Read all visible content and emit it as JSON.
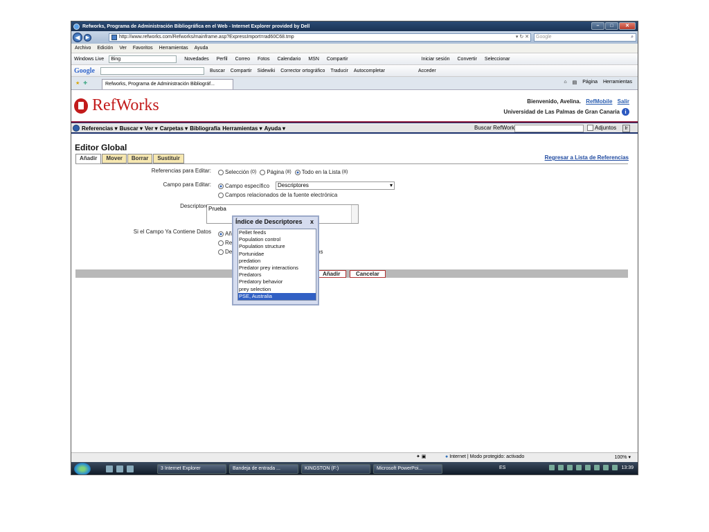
{
  "window": {
    "title": "Refworks, Programa de Administración Bibliográfica en el Web - Internet Explorer provided by Dell",
    "url": "http://www.refworks.com/Refworks/mainframe.asp?ExpressImport=rad60C68.tmp",
    "search_placeholder": "Google"
  },
  "menu": [
    "Archivo",
    "Edición",
    "Ver",
    "Favoritos",
    "Herramientas",
    "Ayuda"
  ],
  "live_toolbar": {
    "brand": "Windows Live",
    "search_value": "Bing",
    "items": [
      "Novedades",
      "Perfil",
      "Correo",
      "Fotos",
      "Calendario",
      "MSN",
      "Compartir"
    ],
    "right_items": [
      "Iniciar sesión",
      "Convertir",
      "Seleccionar"
    ]
  },
  "google_toolbar": {
    "brand": "Google",
    "items": [
      "Buscar",
      "Compartir",
      "Sidewiki",
      "Corrector ortográfico",
      "Traducir",
      "Autocompletar",
      "Acceder"
    ]
  },
  "tab": {
    "label": "Refworks, Programa de Administración Bibliográf...",
    "tools": [
      "Página",
      "Herramientas"
    ]
  },
  "header": {
    "logo": "RefWorks",
    "welcome": "Bienvenido, Avelina.",
    "refmobile": "RefMobile",
    "salir": "Salir",
    "university": "Universidad de Las Palmas de Gran Canaria"
  },
  "nav": {
    "items": [
      "Referencias",
      "Buscar",
      "Ver",
      "Carpetas",
      "Bibliografía",
      "Herramientas",
      "Ayuda"
    ],
    "search_label": "Buscar RefWorks",
    "attachments_label": "Adjuntos",
    "go_label": "Ir"
  },
  "editor": {
    "title": "Editor Global",
    "tabs": [
      "Añadir",
      "Mover",
      "Borrar",
      "Sustituir"
    ],
    "back_link": "Regresar a Lista de Referencias",
    "refs_label": "Referencias para Editar:",
    "refs_options": [
      {
        "label": "Selección",
        "count": "(0)"
      },
      {
        "label": "Página",
        "count": "(8)"
      },
      {
        "label": "Todo en la Lista",
        "count": "(8)"
      }
    ],
    "field_label": "Campo para Editar:",
    "field_option_specific": "Campo específico",
    "field_select_value": "Descriptores",
    "field_option_related": "Campos relacionados de la fuente electrónica",
    "desc_label": "Descriptores",
    "desc_value": "Prueba",
    "if_data_label": "Si el Campo Ya Contiene Datos",
    "if_data_options": [
      "Añ",
      "Re",
      "De"
    ],
    "if_data_tail": "os",
    "add_button": "Añadir",
    "cancel_button": "Cancelar"
  },
  "popup": {
    "title": "Índice de Descriptores",
    "close": "x",
    "items": [
      "Pellet feeds",
      "Population control",
      "Population structure",
      "Portunidae",
      "predation",
      "Predator prey interactions",
      "Predators",
      "Predatory behavior",
      "prey selection",
      "PSE, Australia"
    ],
    "selected_index": 9
  },
  "statusbar": {
    "zone": "Internet | Modo protegido: activado",
    "zoom": "100%"
  },
  "taskbar": {
    "buttons": [
      "3 Internet Explorer",
      "Bandeja de entrada ...",
      "KINGSTON (F:)",
      "Microsoft PowerPoi..."
    ],
    "lang": "ES",
    "clock": "13:39"
  },
  "colors": {
    "brand_red": "#c21b1b",
    "link_blue": "#2a5db0",
    "selection_blue": "#3160c4"
  }
}
